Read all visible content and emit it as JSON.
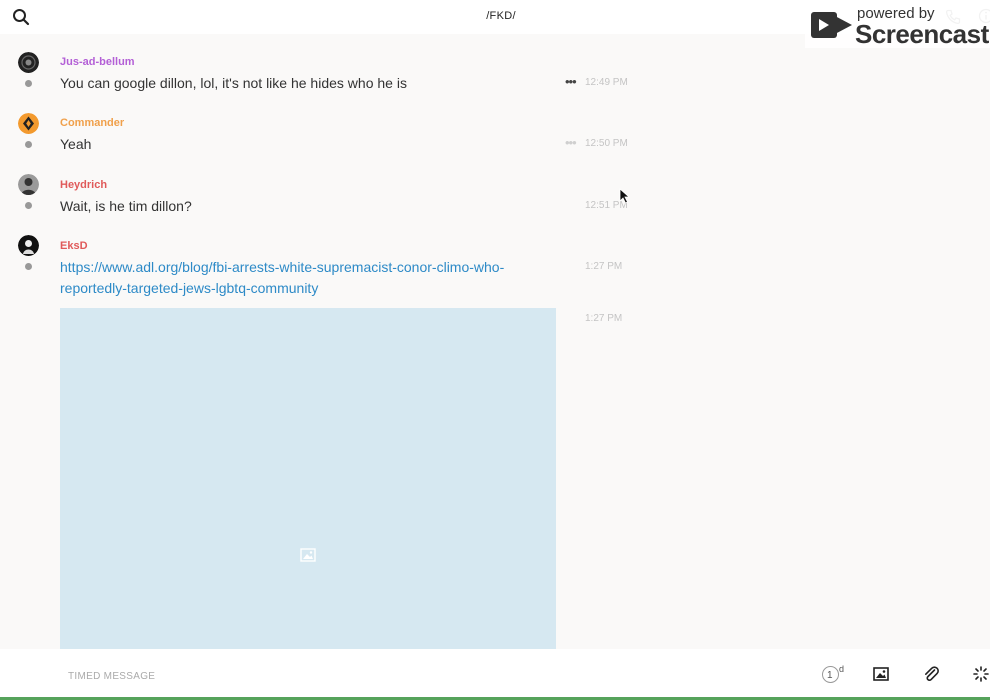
{
  "header": {
    "title": "/FKD/"
  },
  "watermark": {
    "powered": "powered by",
    "brand": "Screencastify"
  },
  "messages": [
    {
      "username": "Jus-ad-bellum",
      "color": "#b35fd6",
      "text": "You can google dillon, lol, it's not like he hides who he is",
      "time": "12:49 PM",
      "more": "•••"
    },
    {
      "username": "Commander",
      "color": "#f0a04b",
      "text": "Yeah",
      "time": "12:50 PM",
      "more": "•••"
    },
    {
      "username": "Heydrich",
      "color": "#e05a5a",
      "text": "Wait, is he tim dillon?",
      "time": "12:51 PM"
    },
    {
      "username": "EksD",
      "color": "#e05a5a",
      "link": "https://www.adl.org/blog/fbi-arrests-white-supremacist-conor-climo-who-reportedly-targeted-jews-lgbtq-community",
      "time": "1:27 PM",
      "image_time": "1:27 PM"
    }
  ],
  "composer": {
    "placeholder": "TIMED MESSAGE",
    "timer_value": "1",
    "timer_unit": "d"
  },
  "icons": {
    "search": "search-icon",
    "phone": "phone-icon",
    "info": "info-icon",
    "image": "image-icon",
    "attach": "paperclip-icon",
    "loading": "spinner-icon"
  }
}
